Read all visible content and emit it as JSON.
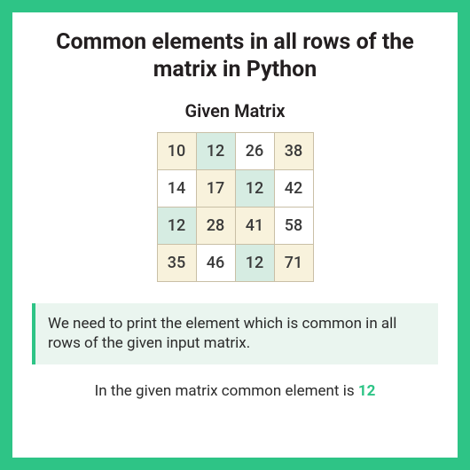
{
  "title": "Common elements in all rows of the matrix in Python",
  "subtitle": "Given Matrix",
  "matrix": {
    "rows": [
      [
        {
          "value": 10,
          "style": "tint"
        },
        {
          "value": 12,
          "style": "hl"
        },
        {
          "value": 26,
          "style": "plain"
        },
        {
          "value": 38,
          "style": "tint"
        }
      ],
      [
        {
          "value": 14,
          "style": "plain"
        },
        {
          "value": 17,
          "style": "tint"
        },
        {
          "value": 12,
          "style": "hl"
        },
        {
          "value": 42,
          "style": "plain"
        }
      ],
      [
        {
          "value": 12,
          "style": "hl"
        },
        {
          "value": 28,
          "style": "tint"
        },
        {
          "value": 41,
          "style": "tint"
        },
        {
          "value": 58,
          "style": "plain"
        }
      ],
      [
        {
          "value": 35,
          "style": "tint"
        },
        {
          "value": 46,
          "style": "plain"
        },
        {
          "value": 12,
          "style": "hl"
        },
        {
          "value": 71,
          "style": "tint"
        }
      ]
    ]
  },
  "explanation": "We need to print the element which is common in all rows of the given input matrix.",
  "result_prefix": "In the given matrix common element is ",
  "common_value": "12"
}
